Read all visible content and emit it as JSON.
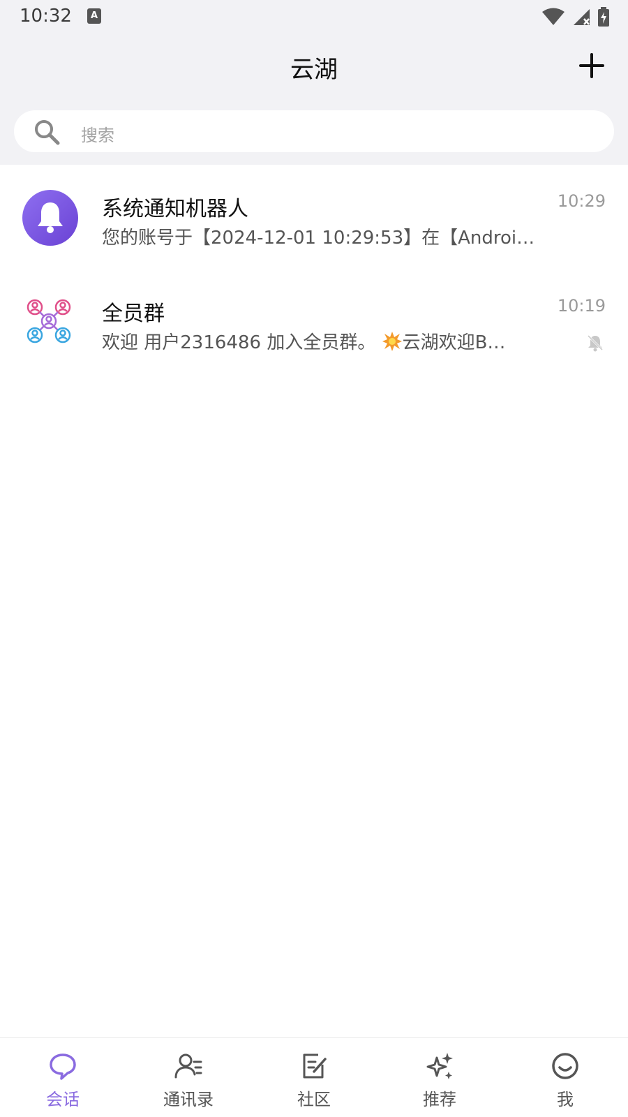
{
  "status_bar": {
    "time": "10:32",
    "badge": "A"
  },
  "header": {
    "title": "云湖"
  },
  "search": {
    "placeholder": "搜索"
  },
  "conversations": [
    {
      "name": "系统通知机器人",
      "preview": "您的账号于【2024-12-01 10:29:53】在【Androi…",
      "time": "10:29",
      "avatar": "bell-avatar-icon",
      "muted": false
    },
    {
      "name": "全员群",
      "preview_prefix": "欢迎 用户2316486 加入全员群。",
      "preview_emoji": "💥",
      "preview_suffix": "云湖欢迎B…",
      "time": "10:19",
      "avatar": "group-avatar-icon",
      "muted": true
    }
  ],
  "bottom_nav": {
    "items": [
      {
        "label": "会话",
        "icon": "chat-bubble-icon",
        "active": true
      },
      {
        "label": "通讯录",
        "icon": "contacts-icon",
        "active": false
      },
      {
        "label": "社区",
        "icon": "community-edit-icon",
        "active": false
      },
      {
        "label": "推荐",
        "icon": "sparkle-icon",
        "active": false
      },
      {
        "label": "我",
        "icon": "smile-icon",
        "active": false
      }
    ]
  },
  "colors": {
    "accent": "#8a6be0",
    "header_bg": "#f2f2f5",
    "avatar_purple": "#7c55e0"
  }
}
